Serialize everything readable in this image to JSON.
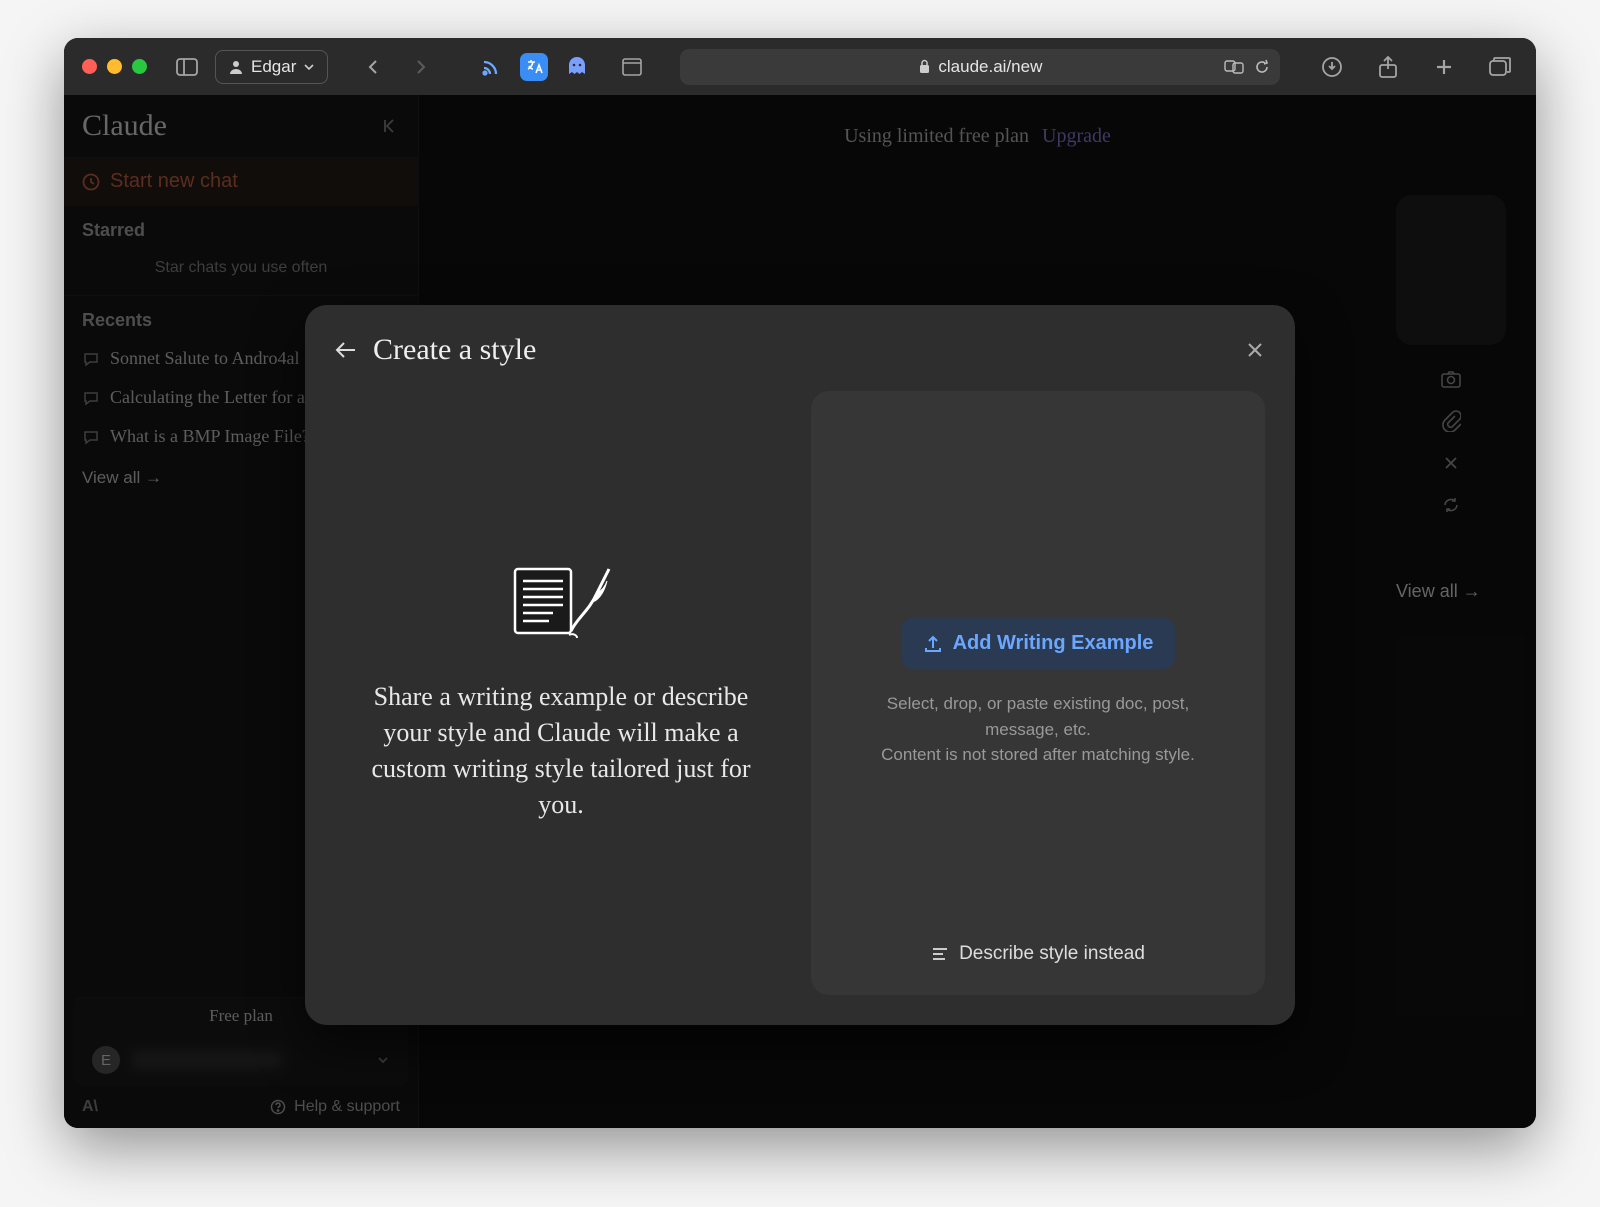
{
  "browser": {
    "user_name": "Edgar",
    "url_display": "claude.ai/new",
    "url_host_lock": true
  },
  "sidebar": {
    "brand": "Claude",
    "new_chat_label": "Start new chat",
    "starred_label": "Starred",
    "starred_empty": "Star chats you use often",
    "recents_label": "Recents",
    "recents": [
      "Sonnet Salute to Andro4al",
      "Calculating the Letter for a",
      "What is a BMP Image File?"
    ],
    "view_all_label": "View all →",
    "plan_label": "Free plan",
    "avatar_initial": "E",
    "help_label": "Help & support"
  },
  "main": {
    "banner_text": "Using limited free plan",
    "upgrade_label": "Upgrade",
    "bg_view_all": "View all →"
  },
  "modal": {
    "title": "Create a style",
    "description": "Share a writing example or describe your style and Claude will make a custom writing style tailored just for you.",
    "add_button_label": "Add Writing Example",
    "helper_line1": "Select, drop, or paste existing doc, post, message, etc.",
    "helper_line2": "Content is not stored after matching style.",
    "describe_link_label": "Describe style instead"
  }
}
